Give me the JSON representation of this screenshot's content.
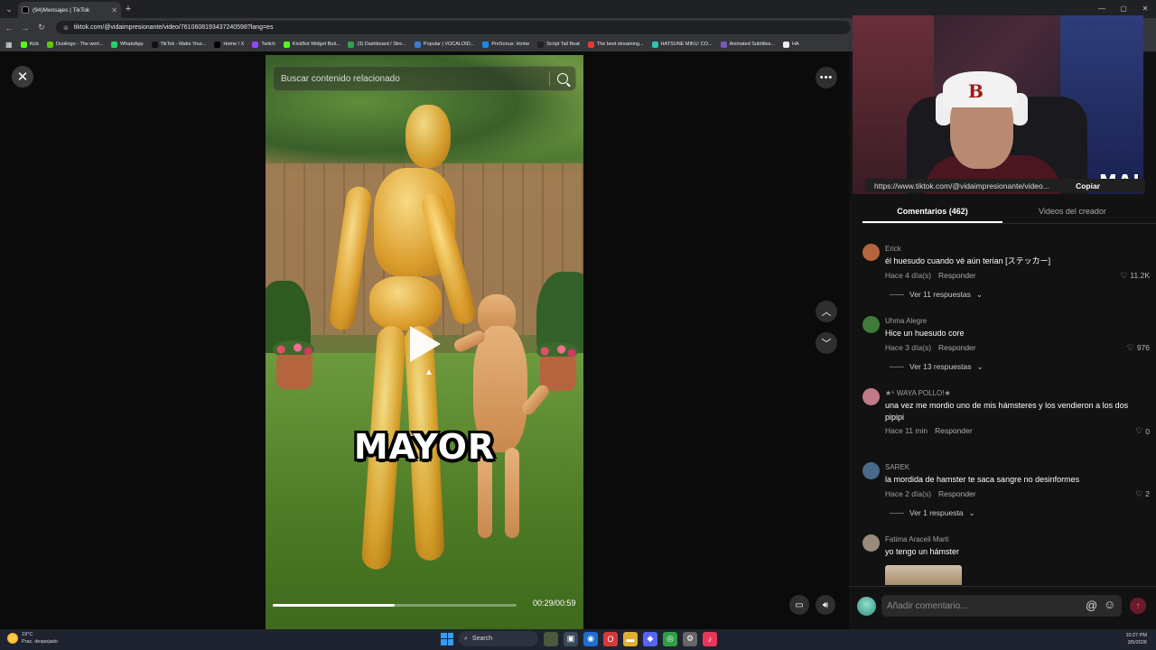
{
  "browser": {
    "tab_title": "(94)Mensajes | TikTok",
    "url": "tiktok.com/@vidaimpresionante/video/7610608193437240598?lang=es",
    "bookmarks": [
      {
        "label": "Kick",
        "color": "#53fc18"
      },
      {
        "label": "Duolingo - The worl...",
        "color": "#58cc02"
      },
      {
        "label": "WhatsApp",
        "color": "#25d366"
      },
      {
        "label": "TikTok - Make Your...",
        "color": "#111111"
      },
      {
        "label": "Home / X",
        "color": "#000000"
      },
      {
        "label": "Twitch",
        "color": "#9146ff"
      },
      {
        "label": "KickBot Widget Buil...",
        "color": "#53fc18"
      },
      {
        "label": "(3) Dashboard / Stre...",
        "color": "#2ea44f"
      },
      {
        "label": "Popular | VOCALOID...",
        "color": "#3a7bd5"
      },
      {
        "label": "PreSonus: Home",
        "color": "#1e88e5"
      },
      {
        "label": "Script Tail Beat",
        "color": "#222222"
      },
      {
        "label": "The best streaming...",
        "color": "#e53935"
      },
      {
        "label": "HATSUNE MIKU: CO...",
        "color": "#2ec4b6"
      },
      {
        "label": "Animated Subtitles...",
        "color": "#7e57c2"
      },
      {
        "label": "HA",
        "color": "#eeeeee"
      }
    ]
  },
  "viewer": {
    "search_placeholder": "Buscar contenido relacionado",
    "overlay_caption": "MAYOR",
    "progress": 0.5,
    "timecode": "00:29/00:59"
  },
  "stream_overlay": {
    "tag": "MAI"
  },
  "panel": {
    "share_url": "https://www.tiktok.com/@vidaimpresionante/video...",
    "copy_label": "Copiar",
    "tabs": [
      {
        "label": "Comentarios (462)"
      },
      {
        "label": "Videos del creador"
      }
    ],
    "comments": [
      {
        "author": "Erick",
        "text": "él huesudo cuando vé aún terian [ステッカー]",
        "time": "Hace 4 día(s)",
        "reply": "Responder",
        "likes": "11.2K",
        "more": "Ver 11 respuestas",
        "avatar_color": "#b5653d"
      },
      {
        "author": "Uhma Alegre",
        "text": "Hice un huesudo core",
        "time": "Hace 3 día(s)",
        "reply": "Responder",
        "likes": "976",
        "more": "Ver 13 respuestas",
        "avatar_color": "#3e7a3a"
      },
      {
        "author": "★⁵ WAYA POLLO!★",
        "text": "una vez me mordio uno de mis hámsteres y los vendieron a los dos pipipi",
        "time": "Hace 11 min",
        "reply": "Responder",
        "likes": "0",
        "more": "",
        "avatar_color": "#c07a8a"
      },
      {
        "author": "SAREK",
        "text": "la mordida de hamster te saca sangre no desinformes",
        "time": "Hace 2 día(s)",
        "reply": "Responder",
        "likes": "2",
        "more": "Ver 1 respuesta",
        "avatar_color": "#4a6a8a"
      },
      {
        "author": "Fatima Araceli Marti",
        "text": "yo tengo un hámster",
        "time": "",
        "reply": "",
        "likes": "",
        "more": "",
        "avatar_color": "#9a8a7a"
      }
    ],
    "comment_placeholder": "Añadir comentario..."
  },
  "taskbar": {
    "weather_temp": "19°C",
    "weather_desc": "Prac. despejado",
    "search_label": "Search",
    "time": "10:27 PM",
    "date": "3/5/2026"
  }
}
